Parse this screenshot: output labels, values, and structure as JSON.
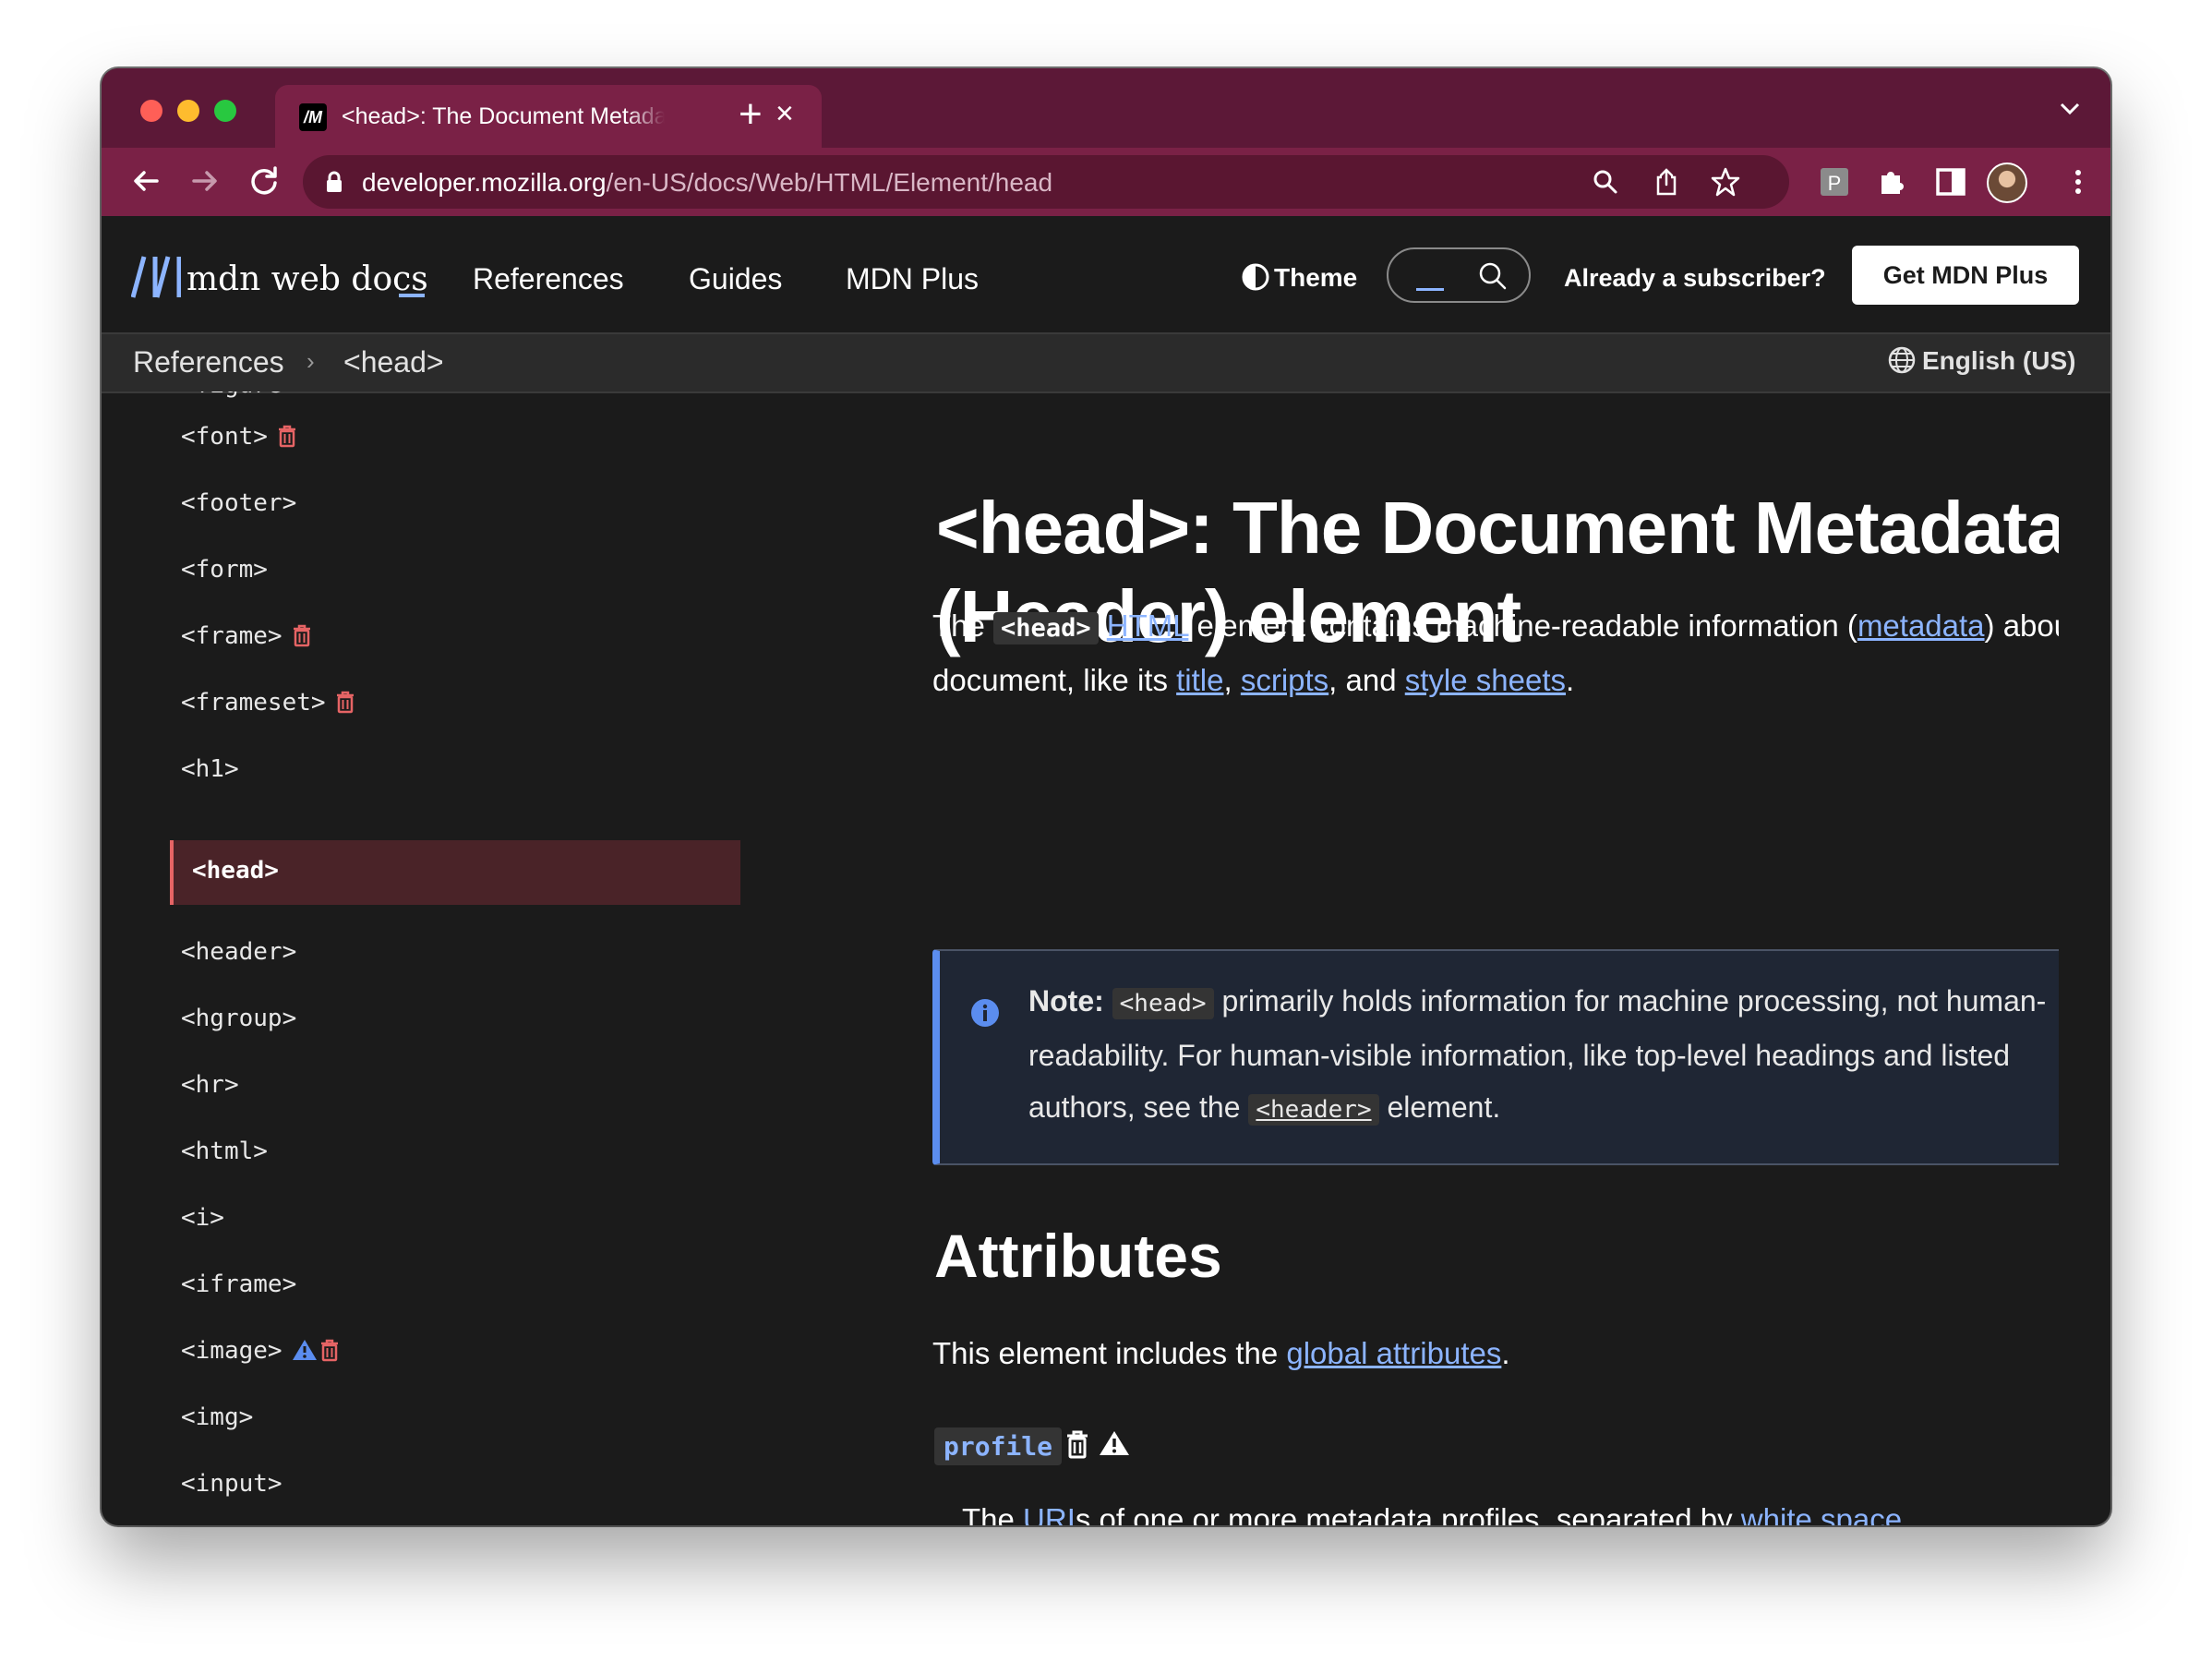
{
  "browser": {
    "tab_title": "<head>: The Document Metadata (Header) element",
    "tab_close": "×",
    "new_tab": "+",
    "url_host": "developer.mozilla.org",
    "url_path": "/en-US/docs/Web/HTML/Element/head",
    "extension_label": "P"
  },
  "header": {
    "logo_text": "mdn web docs",
    "menu": [
      "References",
      "Guides",
      "MDN Plus"
    ],
    "theme_label": "Theme",
    "subscriber_label": "Already a subscriber?",
    "get_plus_label": "Get MDN Plus"
  },
  "breadcrumb": {
    "items": [
      "References",
      "<head>"
    ],
    "separator": "›",
    "language": "English (US)"
  },
  "sidebar": {
    "cut_item": "<figure>",
    "items": [
      {
        "label": "<font>",
        "badges": [
          "deprecated"
        ]
      },
      {
        "label": "<footer>",
        "badges": []
      },
      {
        "label": "<form>",
        "badges": []
      },
      {
        "label": "<frame>",
        "badges": [
          "deprecated"
        ]
      },
      {
        "label": "<frameset>",
        "badges": [
          "deprecated"
        ]
      },
      {
        "label": "<h1>",
        "badges": []
      },
      {
        "label": "<head>",
        "badges": [],
        "active": true
      },
      {
        "label": "<header>",
        "badges": []
      },
      {
        "label": "<hgroup>",
        "badges": []
      },
      {
        "label": "<hr>",
        "badges": []
      },
      {
        "label": "<html>",
        "badges": []
      },
      {
        "label": "<i>",
        "badges": []
      },
      {
        "label": "<iframe>",
        "badges": []
      },
      {
        "label": "<image>",
        "badges": [
          "non-standard",
          "deprecated"
        ]
      },
      {
        "label": "<img>",
        "badges": []
      },
      {
        "label": "<input>",
        "badges": []
      }
    ]
  },
  "article": {
    "title": "<head>: The Document Metadata (Header) element",
    "intro": {
      "t1": "The ",
      "code": "<head>",
      "link_html": "HTML",
      "t2": " element contains machine-readable information (",
      "link_metadata": "metadata",
      "t3": ") about the document, like its ",
      "link_title": "title",
      "t4": ", ",
      "link_scripts": "scripts",
      "t5": ", and ",
      "link_styles": "style sheets",
      "t6": "."
    },
    "note": {
      "label": "Note:",
      "code1": "<head>",
      "t1": " primarily holds information for machine processing, not human-readability. For human-visible information, like top-level headings and listed authors, see the ",
      "code2": "<header>",
      "t2": " element."
    },
    "attributes_heading": "Attributes",
    "attributes_intro": {
      "t1": "This element includes the ",
      "link": "global attributes",
      "t2": "."
    },
    "profile": {
      "name": "profile",
      "t1": "The ",
      "link_uri": "URI",
      "t2": "s of one or more metadata profiles, separated by ",
      "link_ws": "white space",
      "t3": "."
    }
  },
  "colors": {
    "tabstrip": "#5c1837",
    "toolbar": "#7a2146",
    "page_bg": "#1b1b1b",
    "link": "#8cb4ff",
    "deprecated": "#e66465",
    "note_accent": "#5b8def"
  }
}
